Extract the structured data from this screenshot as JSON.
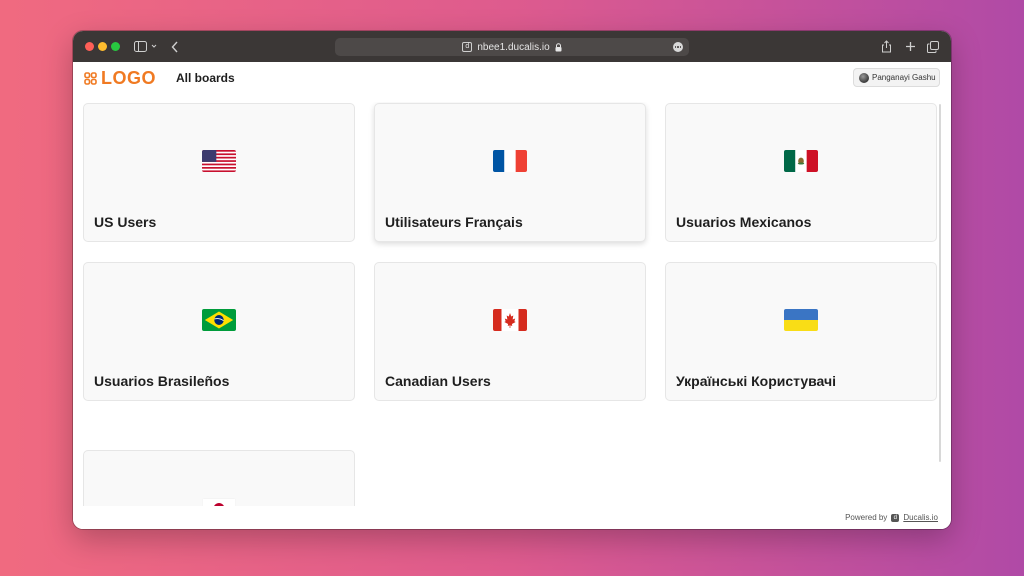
{
  "browser": {
    "url": "nbee1.ducalis.io",
    "site_badge": "d"
  },
  "header": {
    "logo_text": "LOGO",
    "nav_title": "All boards",
    "user_name": "Panganayi Gashu"
  },
  "boards": [
    {
      "title": "US Users",
      "flag": "us-flag-icon"
    },
    {
      "title": "Utilisateurs Français",
      "flag": "fr-flag-icon"
    },
    {
      "title": "Usuarios Mexicanos",
      "flag": "mx-flag-icon"
    },
    {
      "title": "Usuarios Brasileños",
      "flag": "br-flag-icon"
    },
    {
      "title": "Canadian Users",
      "flag": "ca-flag-icon"
    },
    {
      "title": "Українські Користувачі",
      "flag": "ua-flag-icon"
    },
    {
      "title": "",
      "flag": "jp-flag-icon"
    }
  ],
  "footer": {
    "powered_by": "Powered by",
    "badge": "d",
    "link": "Ducalis.io"
  },
  "colors": {
    "brand": "#f07a22",
    "card_background": "#f9f9f9"
  }
}
